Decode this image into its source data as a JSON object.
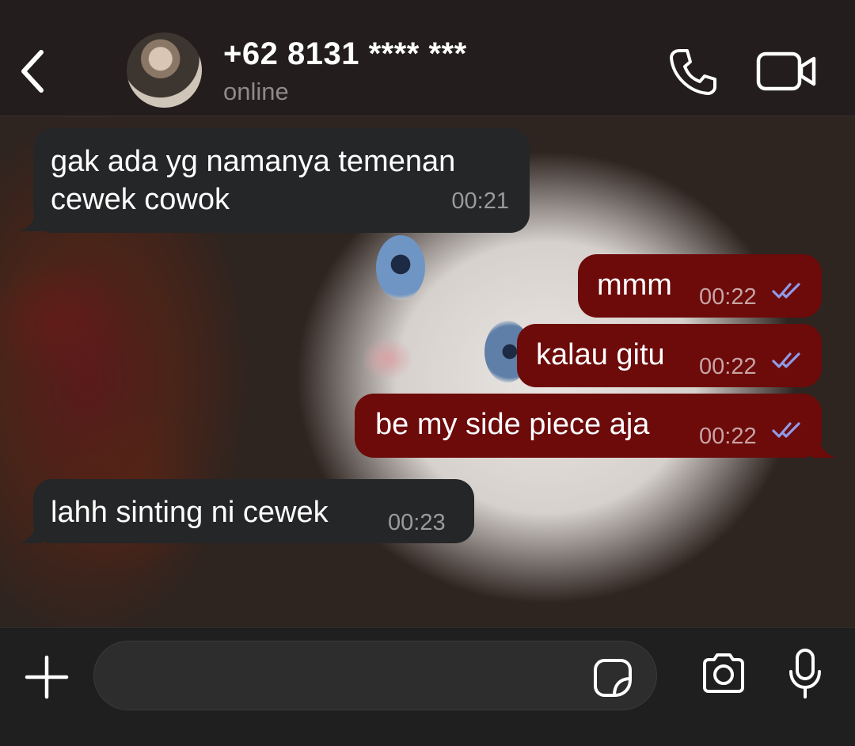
{
  "header": {
    "contact_name": "+62 8131 **** ***",
    "status": "online",
    "icons": [
      "chevron-left-icon",
      "phone-icon",
      "video-camera-icon"
    ]
  },
  "messages": [
    {
      "direction": "incoming",
      "lines": [
        "gak ada yg namanya temenan",
        "cewek cowok"
      ],
      "time": "00:21"
    },
    {
      "direction": "outgoing",
      "text": "mmm",
      "time": "00:22",
      "status": "read"
    },
    {
      "direction": "outgoing",
      "text": "kalau gitu",
      "time": "00:22",
      "status": "read"
    },
    {
      "direction": "outgoing",
      "text": "be my side piece aja",
      "time": "00:22",
      "status": "read"
    },
    {
      "direction": "incoming",
      "text": "lahh sinting ni cewek",
      "time": "00:23"
    }
  ],
  "composer": {
    "placeholder": "",
    "icons": [
      "plus-icon",
      "sticker-icon",
      "camera-icon",
      "microphone-icon"
    ]
  },
  "colors": {
    "incoming_bubble": "#252627",
    "outgoing_bubble": "#6d0a0a",
    "read_tick": "#8f9bea"
  }
}
